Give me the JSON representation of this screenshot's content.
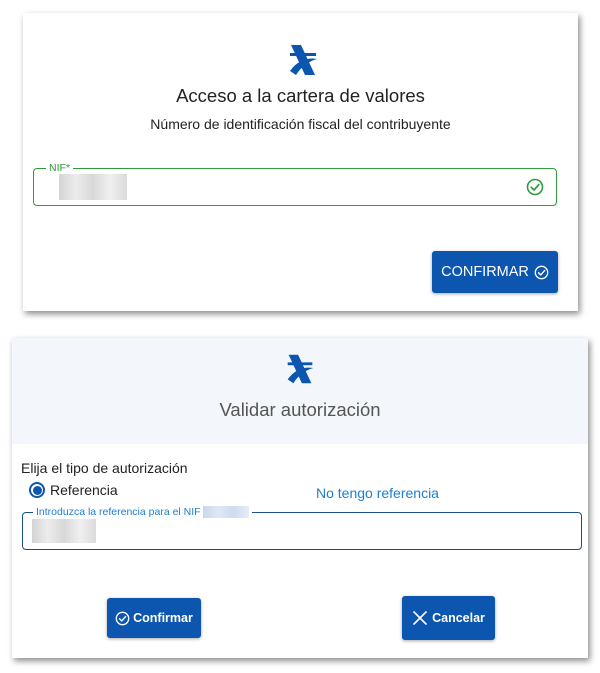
{
  "colors": {
    "brand_blue": "#0c56b0",
    "success_green": "#2e9a3b",
    "link_blue": "#1e7ed0",
    "header_bg": "#f3f6fa"
  },
  "dialog1": {
    "logo_icon": "agencia-tributaria-logo",
    "title": "Acceso a la cartera de valores",
    "subtitle": "Número de identificación fiscal del contribuyente",
    "nif_field": {
      "label": "NIF*",
      "value": "",
      "status_icon": "check-circle-icon"
    },
    "confirm_label": "CONFIRMAR",
    "confirm_icon": "check-circle-icon"
  },
  "dialog2": {
    "logo_icon": "agencia-tributaria-logo",
    "title": "Validar autorización",
    "auth_type_label": "Elija el tipo de autorización",
    "radio_option": "Referencia",
    "radio_selected": true,
    "no_reference_link": "No tengo referencia",
    "reference_field": {
      "label": "Introduzca la referencia para el NIF",
      "value": ""
    },
    "confirm_label": "Confirmar",
    "confirm_icon": "check-circle-icon",
    "cancel_label": "Cancelar",
    "cancel_icon": "close-icon"
  }
}
